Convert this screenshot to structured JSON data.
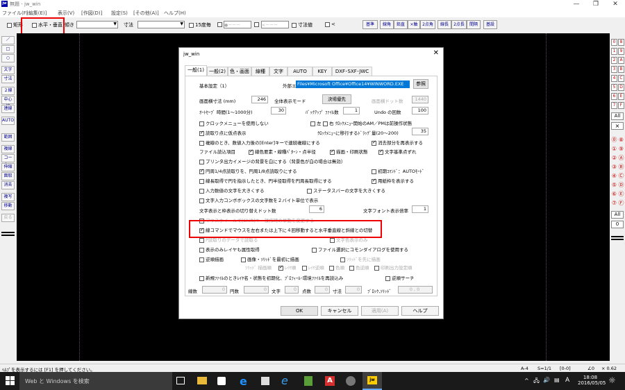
{
  "window": {
    "title": "無題 - jw_win",
    "app_icon": "jw"
  },
  "menu": [
    "ファイル(F)",
    "[編集(E)]",
    "表示(V)",
    "[作図(D)]",
    "設定(S)",
    "[その他(A)]",
    "ヘルプ(H)"
  ],
  "toolbar": {
    "rect_label": "矩形",
    "hv_label": "水平・垂直",
    "tilt_label": "傾き",
    "dim_label": "寸法",
    "deg15_label": "15度毎",
    "circle_placeholder": "●－－－",
    "arrow_placeholder": "<－－－",
    "dimval_label": "寸法値",
    "lt_label": "<",
    "buttons": [
      "基準",
      "線角",
      "鉛直",
      "×軸",
      "2点角",
      "線長",
      "2点長",
      "間隔",
      "基設"
    ]
  },
  "left_tools": [
    "／",
    "□",
    "○",
    "文字",
    "寸法",
    "２線",
    "中心線",
    "連線",
    "AUTO",
    "範囲",
    "複線",
    "コーナー",
    "伸縮",
    "面取",
    "消去",
    "複写",
    "移動",
    "戻る"
  ],
  "right_tools": [
    [
      "0",
      "8"
    ],
    [
      "1",
      "9"
    ],
    [
      "2",
      "A"
    ],
    [
      "3",
      "B"
    ],
    [
      "4",
      "C"
    ],
    [
      "5",
      "D"
    ],
    [
      "6",
      "E"
    ],
    [
      "7",
      "F"
    ]
  ],
  "right_all1": "All",
  "right_x": "×",
  "right_circ": [
    [
      "⓪",
      "⑧"
    ],
    [
      "①",
      "⑨"
    ],
    [
      "②",
      "Ⓐ"
    ],
    [
      "③",
      "Ⓑ"
    ],
    [
      "④",
      "Ⓒ"
    ],
    [
      "⑤",
      "Ⓓ"
    ],
    [
      "⑥",
      "Ⓔ"
    ],
    [
      "⑦",
      "Ⓕ"
    ]
  ],
  "right_all2": "All",
  "right_zero": "0",
  "status": {
    "help": "ﾍﾙﾌﾟを表示するには [F1] を押してください。",
    "scale_a": "A-4",
    "scale_s": "S=1/1",
    "layer": "[0-0]",
    "angle": "∠0",
    "zoom": "× 0.62"
  },
  "taskbar": {
    "search": "Web と Windows を検索",
    "time": "18:08",
    "date": "2016/05/05",
    "ime": "A"
  },
  "dialog": {
    "title": "jw_win",
    "tabs": [
      "一般(1)",
      "一般(2)",
      "色・画面",
      "線種",
      "文字",
      "AUTO",
      "KEY",
      "DXF･SXF･JWC"
    ],
    "section": "基本設定（1）",
    "ext_editor_label": "外部エディタ",
    "ext_editor_path": "Files¥Microsoft Office¥Office14¥WINWORD.EXE",
    "browse": "参照",
    "screen_size_label": "画面横寸法 (mm)",
    "screen_size": "246",
    "fullmode_label": "全体表示モード",
    "fullmode_btn": "決場優先",
    "dots_label": "画面横ドット数",
    "dots": "1440",
    "autosave_label": "ｵｰﾄｾｰﾌﾞ 時間(1～1000分)",
    "autosave": "30",
    "backup_label": "ﾊﾞｯｸｱｯﾌﾟ ﾌｧｲﾙ数",
    "backup": "1",
    "undo_label": "Undo の回数",
    "undo": "100",
    "opt_clockmenu": "クロックメニューを使用しない",
    "opt_left": "左",
    "opt_right": "右 ｸﾛｯｸﾒﾆｭｰ開始のAM／PMは前操作状態",
    "opt_tempread": "読取り点に仮点表示",
    "drag_label": "ｸﾛｯｸﾒﾆｭｰに移行するﾄﾞﾗｯｸﾞ量(20～200)",
    "drag": "35",
    "opt_continuous": "複線のとき、数値入力後の[Enter]キーで連続複線にする",
    "opt_erase_redraw": "消去部分を再表示する",
    "fileread_label": "ファイル読込項目",
    "opt_linecolor": "線色要素・線種ﾊﾟﾀｰﾝ・点半径",
    "opt_drawprint": "描画・印刷状態",
    "opt_textbase": "文字基準点ずれ",
    "opt_printer": "プリンタ出力イメージの背景を白にする（背景色が白の場合は無効）",
    "opt_arc": "円周1/4点読取りを、円周1/8点読取りにする",
    "opt_initcmd": "初期ｺﾏﾝﾄﾞ：AUTOﾓｰﾄﾞ",
    "opt_linelen": "線長取得で円を指示したとき、円半径取得を円周長取得にする",
    "opt_paperframe": "用紙枠を表示する",
    "opt_bigtext": "入力数値の文字を大きくする",
    "opt_statustext": "ステータスバーの文字を大きくする",
    "opt_combo2byte": "文字入力コンボボックスの文字数を２バイト単位で表示",
    "switch_label": "文字表示と枠表示の切り替えドット数",
    "switch": "6",
    "fontrate_label": "文字フォント表示倍率",
    "fontrate": "1",
    "opt_hidden": "マウスホイールで[Shift]キー操作時の挙動を変更する",
    "opt_hvswitch": "線コマンドでマウスを左右または上下に４回移動すると水平垂直線と斜線との切替",
    "opt_disabled1": "P読取りのデータで読取る",
    "opt_disabled2": "文字色表示のみ",
    "opt_layerattr": "表示のみレイヤも属性取得",
    "opt_commondlg": "ファイル選択にコモンダイアログを使用する",
    "opt_reverse": "逆順描画",
    "opt_imagesolid": "画像・ｿﾘｯﾄﾞを最初に描画",
    "opt_solidfirst": "ｿﾘｯﾄﾞを先に描画",
    "solid_order_label": "ｿﾘｯﾄﾞ 描画順",
    "opt_layerorder": "ﾚｲﾔ順",
    "opt_layerrev": "ﾚｲﾔ逆順",
    "opt_colororder": "色順",
    "opt_colorrev": "色逆順",
    "opt_printorder": "印刷出力設定順",
    "opt_newfile": "新規ﾌｧｲﾙのときﾚｲﾔ名・状態を初期化、ﾌﾟﾛﾌｨｰﾙ･環境ﾌｧｲﾙを再読込み",
    "opt_revsearch": "逆順サーチ",
    "counts": [
      {
        "label": "線数",
        "value": "0"
      },
      {
        "label": "円数",
        "value": "0"
      },
      {
        "label": "文字",
        "value": "0"
      },
      {
        "label": "点数",
        "value": "0"
      },
      {
        "label": "寸法",
        "value": "0"
      },
      {
        "label": "ﾌﾞﾛｯｸ,ｿﾘｯﾄﾞ",
        "value": "0 , 0"
      }
    ],
    "ok": "OK",
    "cancel": "キャンセル",
    "apply": "適用(A)",
    "help": "ヘルプ"
  }
}
